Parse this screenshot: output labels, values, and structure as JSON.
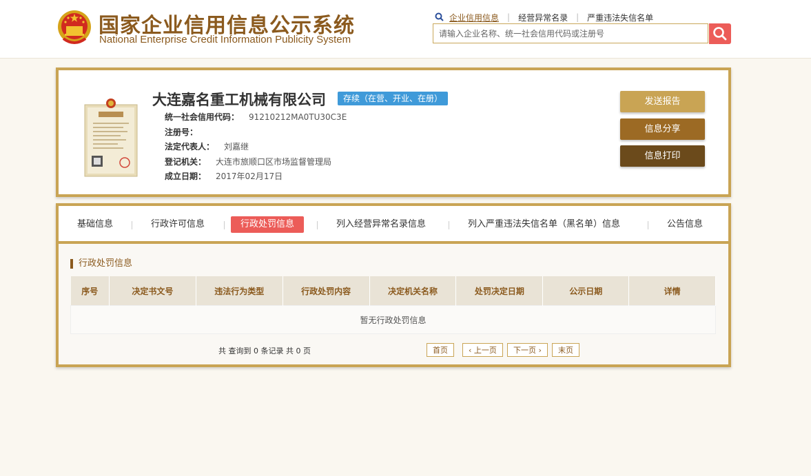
{
  "header": {
    "title_cn": "国家企业信用信息公示系统",
    "title_en": "National Enterprise Credit Information Publicity System",
    "nav": [
      {
        "label": "企业信用信息"
      },
      {
        "label": "经营异常名录"
      },
      {
        "label": "严重违法失信名单"
      }
    ],
    "search_placeholder": "请输入企业名称、统一社会信用代码或注册号"
  },
  "company": {
    "name": "大连嘉名重工机械有限公司",
    "status": "存续（在营、开业、在册）",
    "fields": [
      {
        "label": "统一社会信用代码：",
        "value": "91210212MA0TU30C3E"
      },
      {
        "label": "注册号：",
        "value": ""
      },
      {
        "label": "法定代表人：",
        "value": "刘嘉继"
      },
      {
        "label": "登记机关：",
        "value": "大连市旅顺口区市场监督管理局"
      },
      {
        "label": "成立日期：",
        "value": "2017年02月17日"
      }
    ],
    "buttons": {
      "send": "发送报告",
      "share": "信息分享",
      "print": "信息打印"
    }
  },
  "tabs": [
    {
      "label": "基础信息"
    },
    {
      "label": "行政许可信息"
    },
    {
      "label": "行政处罚信息"
    },
    {
      "label": "列入经营异常名录信息"
    },
    {
      "label": "列入严重违法失信名单（黑名单）信息"
    },
    {
      "label": "公告信息"
    }
  ],
  "active_tab": "行政处罚信息",
  "section": {
    "title": "行政处罚信息",
    "columns": [
      "序号",
      "决定书文号",
      "违法行为类型",
      "行政处罚内容",
      "决定机关名称",
      "处罚决定日期",
      "公示日期",
      "详情"
    ],
    "empty_text": "暂无行政处罚信息"
  },
  "pagination": {
    "info": "共 查询到 0 条记录 共 0 页",
    "first": "首页",
    "prev": "上一页",
    "next": "下一页",
    "last": "末页"
  },
  "colors": {
    "gold": "#c9a454",
    "brown": "#8b5a1e",
    "accent_red": "#ec5c58",
    "status_blue": "#3f9ad9"
  }
}
